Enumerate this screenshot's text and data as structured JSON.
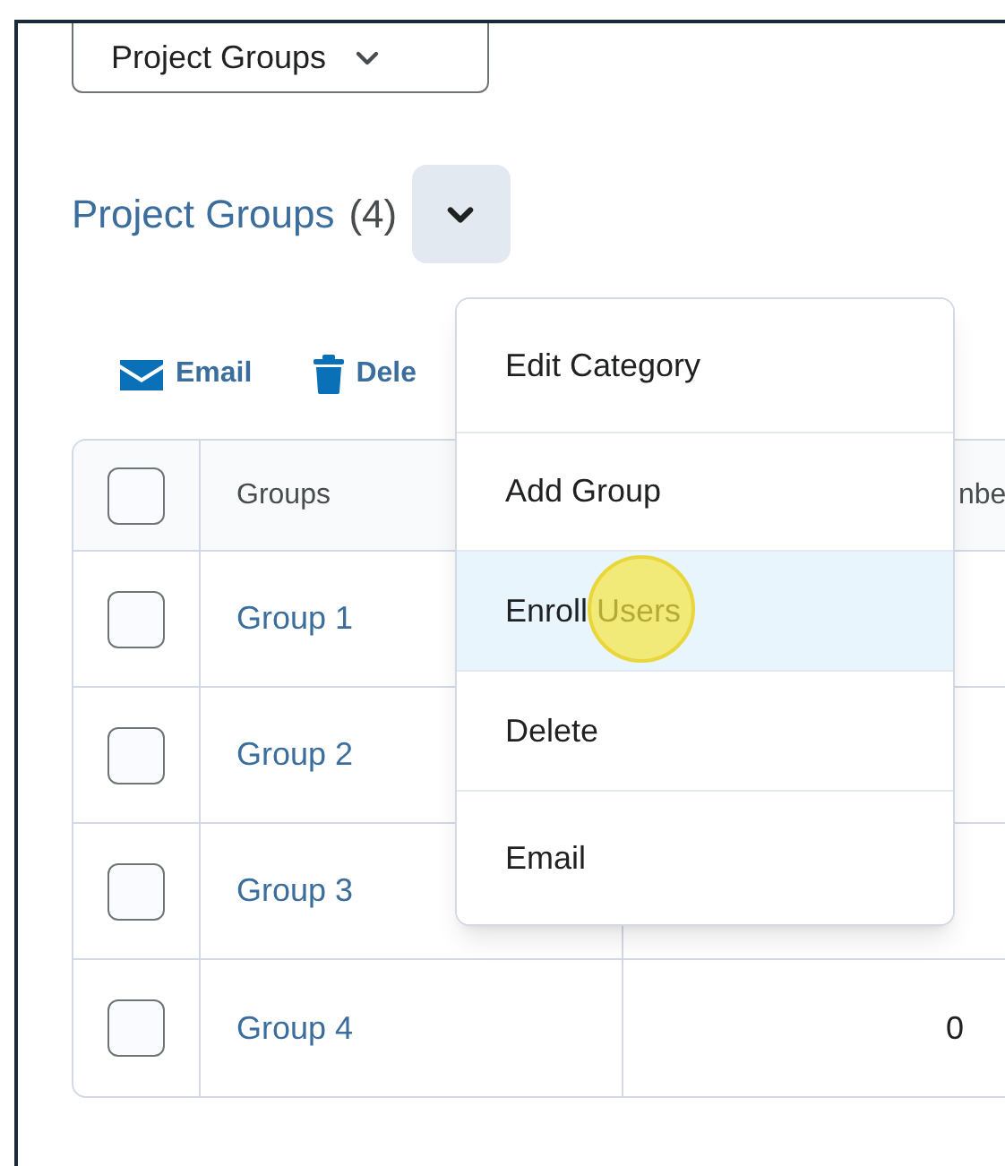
{
  "category_select": {
    "value": "Project Groups"
  },
  "heading": {
    "title": "Project Groups",
    "count": "(4)",
    "expanded": true
  },
  "toolbar": [
    {
      "kind": "email",
      "label": "Email"
    },
    {
      "kind": "delete",
      "label": "Dele"
    }
  ],
  "table": {
    "select_all_checked": false,
    "columns": [
      "Groups",
      "nbe"
    ],
    "rows": [
      {
        "checked": false,
        "name": "Group 1"
      },
      {
        "checked": false,
        "name": "Group 2"
      },
      {
        "checked": false,
        "name": "Group 3"
      },
      {
        "checked": false,
        "name": "Group 4",
        "column_3": "0"
      }
    ]
  },
  "menu": {
    "items": [
      {
        "label": "Edit Category",
        "selected": false
      },
      {
        "label": "Add Group",
        "selected": false
      },
      {
        "label": "Enroll Users",
        "selected": true
      },
      {
        "label": "Delete",
        "selected": false
      },
      {
        "label": "Email",
        "selected": false
      }
    ]
  }
}
